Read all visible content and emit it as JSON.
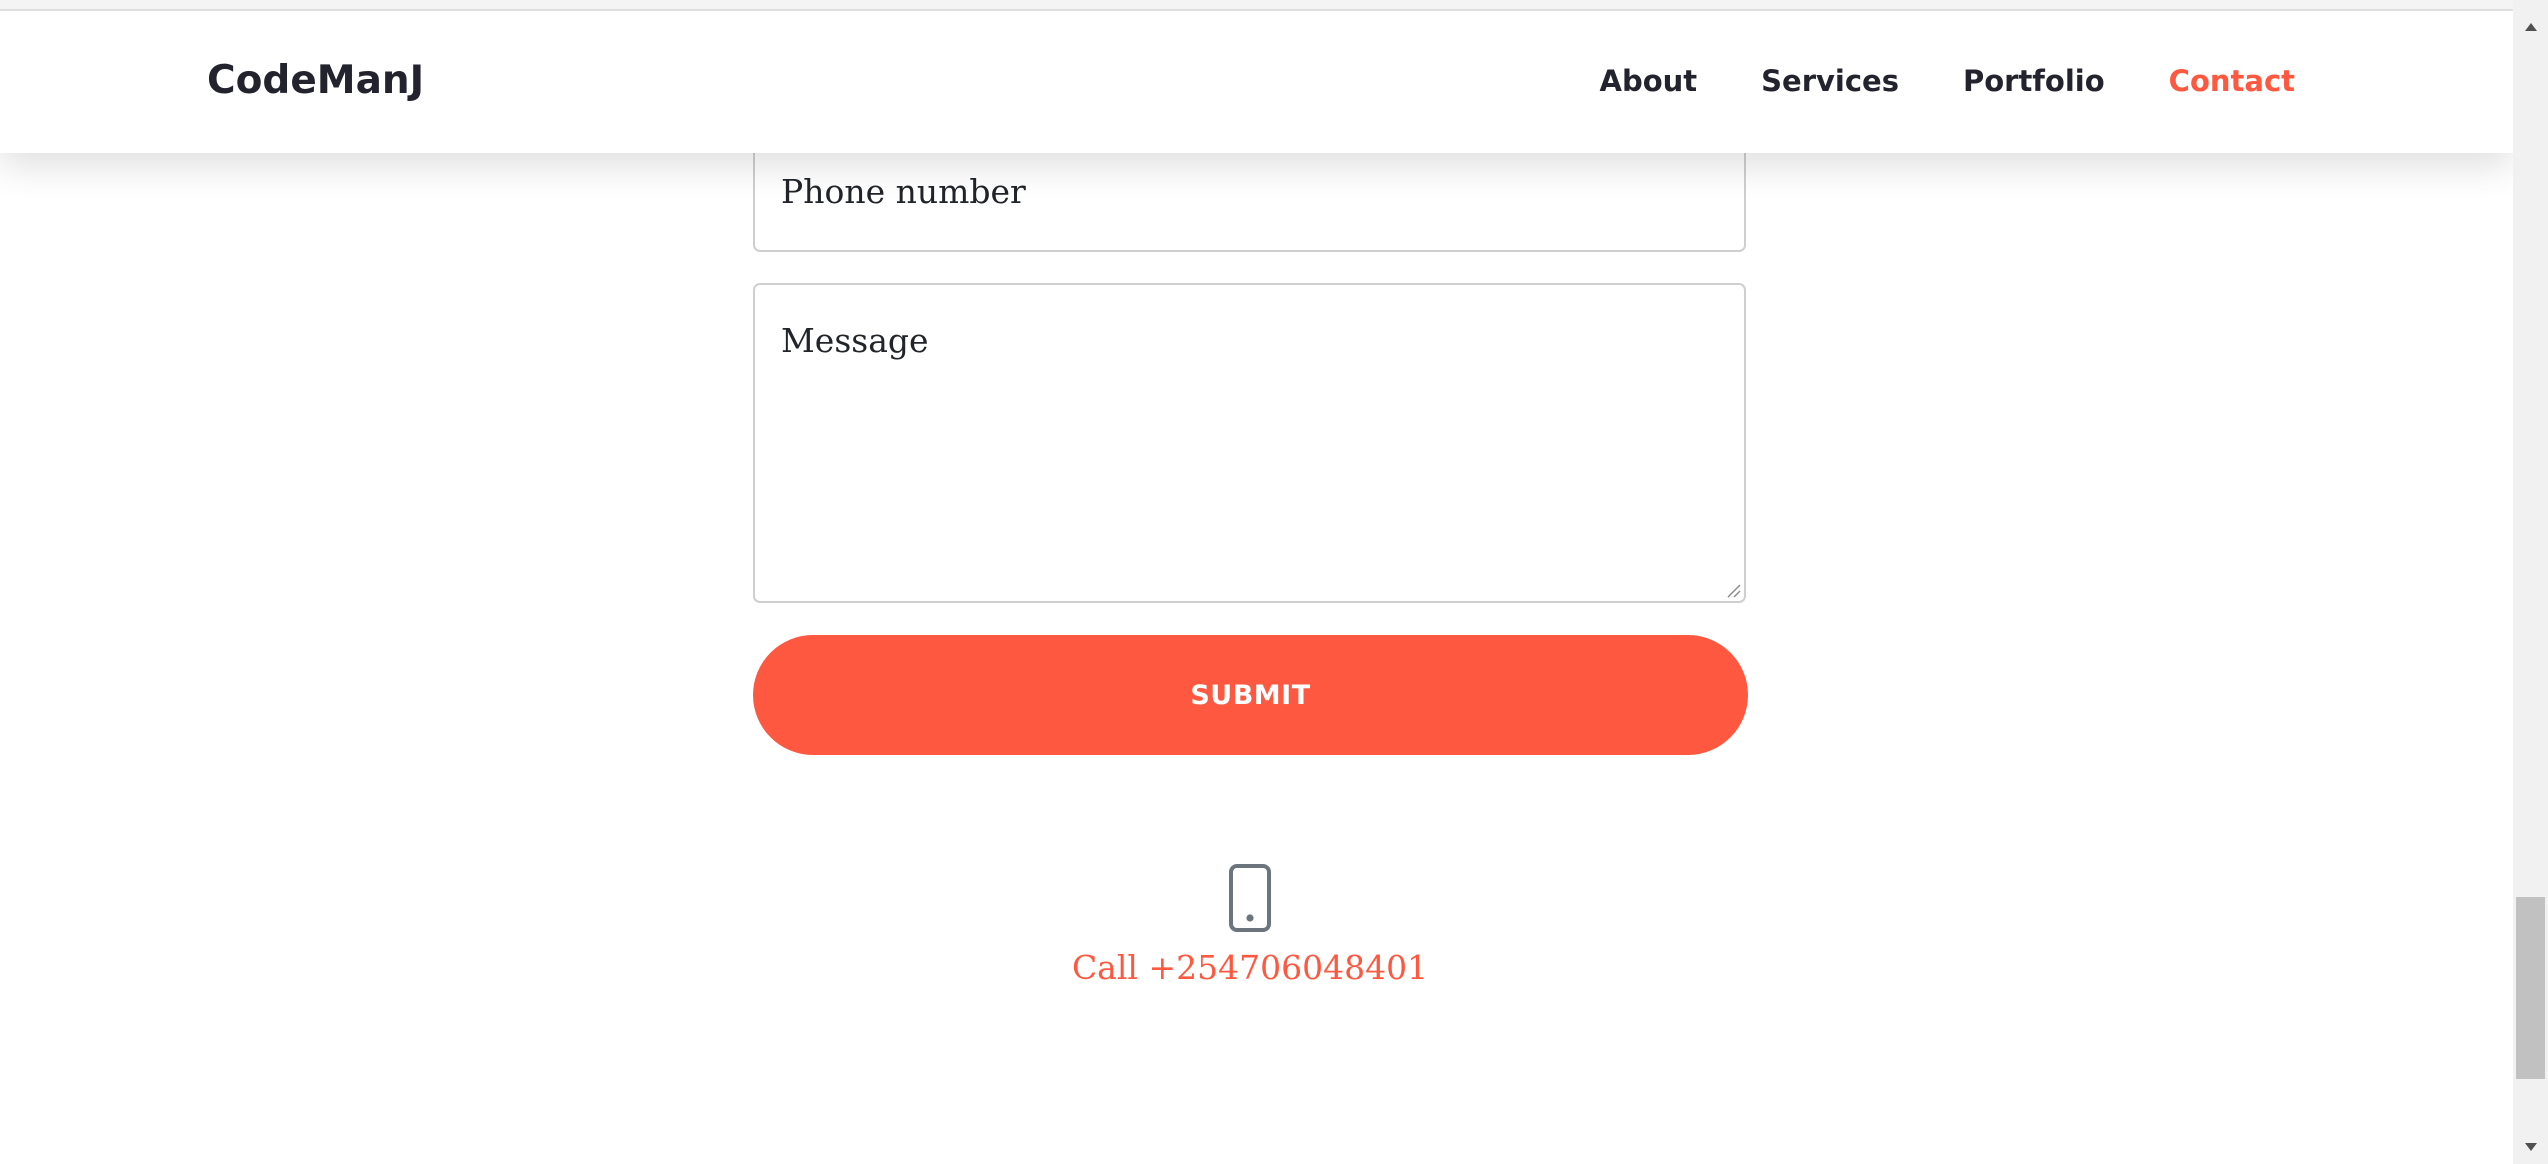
{
  "header": {
    "brand": "CodeManJ",
    "nav": [
      {
        "label": "About",
        "active": false
      },
      {
        "label": "Services",
        "active": false
      },
      {
        "label": "Portfolio",
        "active": false
      },
      {
        "label": "Contact",
        "active": true
      }
    ]
  },
  "form": {
    "phone_placeholder": "Phone number",
    "message_placeholder": "Message",
    "submit_label": "SUBMIT"
  },
  "contact": {
    "icon": "mobile-phone-icon",
    "call_text": "Call +254706048401"
  },
  "colors": {
    "accent": "#ff5841",
    "text": "#23232e",
    "border": "#cfcfcf"
  }
}
